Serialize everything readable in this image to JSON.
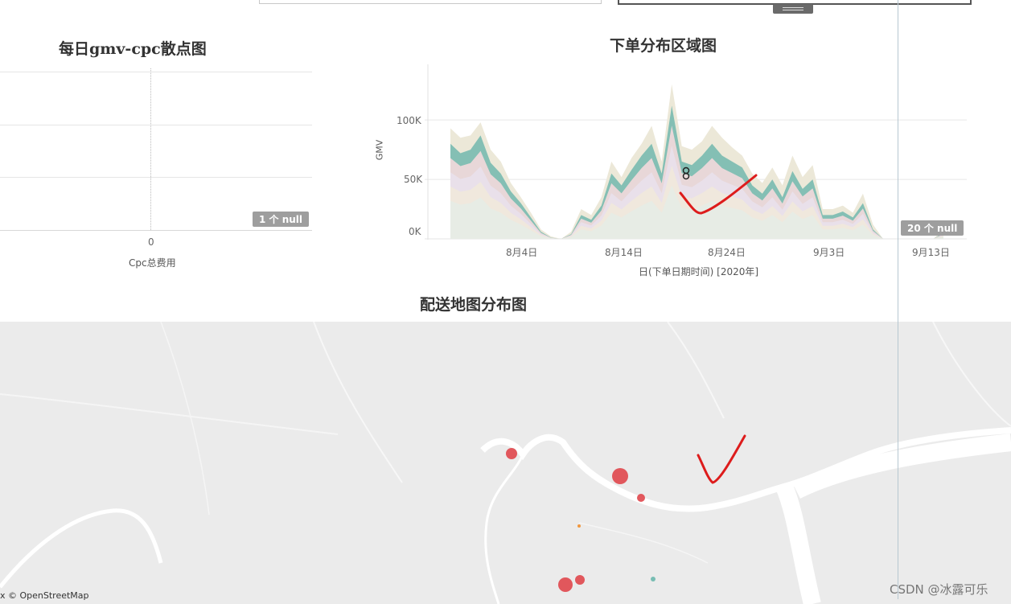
{
  "scatter_panel": {
    "title": "每日gmv-cpc散点图",
    "x_tick": "0",
    "x_axis_label": "Cpc总费用",
    "null_badge": "1 个 null"
  },
  "area_panel": {
    "title": "下单分布区域图",
    "y_axis_label": "GMV",
    "y_ticks": [
      "100K",
      "50K",
      "0K"
    ],
    "x_ticks": [
      "8月4日",
      "8月14日",
      "8月24日",
      "9月3日",
      "9月13日"
    ],
    "x_axis_label": "日(下单日期时间) [2020年]",
    "null_badge": "20 个 null"
  },
  "map_panel": {
    "title": "配送地图分布图",
    "attribution": "x © OpenStreetMap",
    "marker_colors": {
      "red": "#e0474c",
      "orange": "#f28e2b",
      "teal": "#6cb8ad"
    }
  },
  "watermark": "CSDN @冰露可乐",
  "chart_data": {
    "type": "area",
    "title": "下单分布区域图",
    "xlabel": "日(下单日期时间) [2020年]",
    "ylabel": "GMV",
    "ylim": [
      0,
      140000
    ],
    "x": [
      "7/26",
      "7/27",
      "7/28",
      "7/29",
      "7/30",
      "7/31",
      "8/1",
      "8/2",
      "8/3",
      "8/4",
      "8/5",
      "8/6",
      "8/7",
      "8/8",
      "8/9",
      "8/10",
      "8/11",
      "8/12",
      "8/13",
      "8/14",
      "8/15",
      "8/16",
      "8/17",
      "8/18",
      "8/19",
      "8/20",
      "8/21",
      "8/22",
      "8/23",
      "8/24",
      "8/25",
      "8/26",
      "8/27",
      "8/28",
      "8/29",
      "8/30",
      "8/31",
      "9/1",
      "9/2",
      "9/3",
      "9/4",
      "9/5",
      "9/6",
      "9/7",
      "9/8",
      "9/9",
      "9/10",
      "9/11",
      "9/12",
      "9/13"
    ],
    "series": [
      {
        "values": [
          93000,
          85000,
          87000,
          98000,
          75000,
          65000,
          47000,
          35000,
          22000,
          8000,
          2000,
          0,
          6000,
          25000,
          20000,
          35000,
          65000,
          52000,
          68000,
          80000,
          95000,
          65000,
          130000,
          78000,
          75000,
          82000,
          95000,
          85000,
          77000,
          70000,
          55000,
          47000,
          60000,
          45000,
          70000,
          52000,
          62000,
          25000,
          25000,
          28000,
          22000,
          38000,
          12000,
          0,
          0,
          0,
          0,
          0,
          0,
          8000
        ]
      },
      {
        "values": [
          80000,
          72000,
          75000,
          87000,
          64000,
          55000,
          40000,
          30000,
          18000,
          6000,
          1000,
          0,
          4000,
          20000,
          16000,
          28000,
          55000,
          45000,
          58000,
          70000,
          80000,
          55000,
          112000,
          65000,
          62000,
          70000,
          80000,
          70000,
          65000,
          60000,
          45000,
          38000,
          50000,
          35000,
          57000,
          42000,
          50000,
          20000,
          20000,
          23000,
          18000,
          30000,
          8000,
          0,
          0,
          0,
          0,
          0,
          0,
          5000
        ]
      }
    ],
    "grid": true
  }
}
